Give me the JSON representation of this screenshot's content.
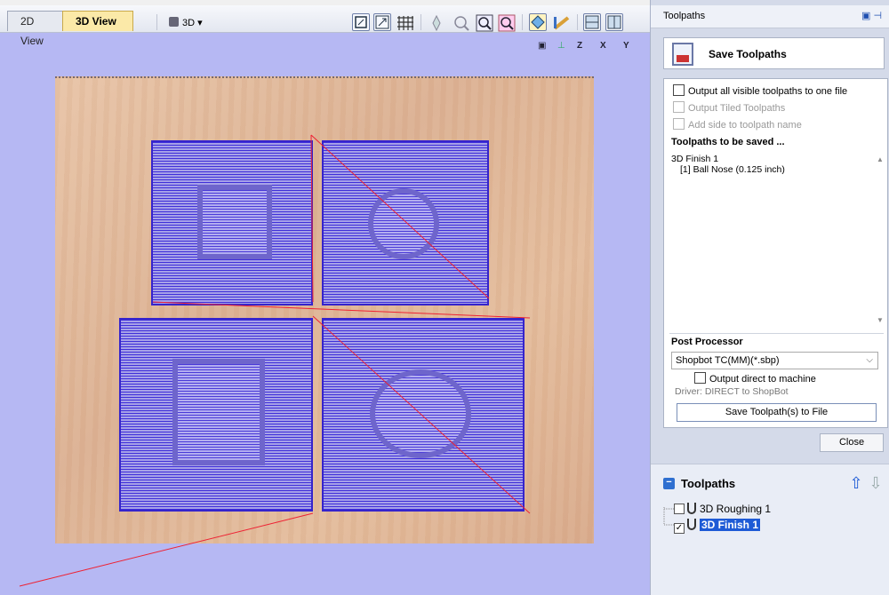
{
  "tabs": [
    {
      "label": "2D View"
    },
    {
      "label": "3D View"
    }
  ],
  "toolbar": {
    "view_dropdown": "3D"
  },
  "view_axis_labels": [
    "Z",
    "X",
    "Y"
  ],
  "panel": {
    "title": "Toolpaths",
    "save_header": "Save Toolpaths",
    "options": [
      {
        "label": "Output all visible toolpaths to one file",
        "enabled": true,
        "checked": false
      },
      {
        "label": "Output Tiled Toolpaths",
        "enabled": false,
        "checked": false
      },
      {
        "label": "Add side to toolpath name",
        "enabled": false,
        "checked": false
      }
    ],
    "to_save_heading": "Toolpaths to be saved ...",
    "to_save_items": [
      "3D Finish 1",
      "[1] Ball Nose (0.125 inch)"
    ],
    "post_processor_heading": "Post Processor",
    "post_processor_value": "Shopbot TC(MM)(*.sbp)",
    "output_direct_label": "Output direct to machine",
    "driver_text": "Driver: DIRECT to ShopBot",
    "save_file_button": "Save Toolpath(s) to File",
    "close_button": "Close"
  },
  "toolpaths_list": {
    "title": "Toolpaths",
    "items": [
      {
        "label": "3D Roughing 1",
        "checked": false,
        "selected": false
      },
      {
        "label": "3D Finish 1",
        "checked": true,
        "selected": true
      }
    ]
  },
  "colors": {
    "accent": "#1e5bd6",
    "toolpath": "#3524cc",
    "viewport_bg": "#b6b8f3",
    "active_tab": "#fbe9a8"
  }
}
